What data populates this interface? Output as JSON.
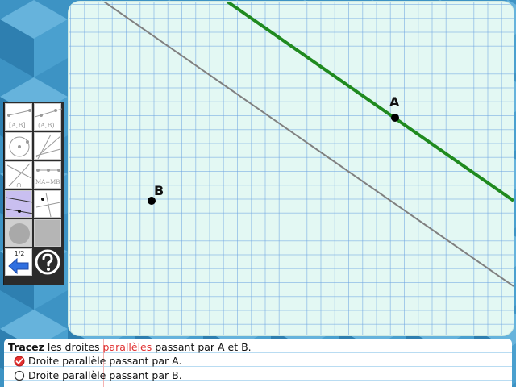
{
  "page": {
    "background": "#3d93c4",
    "canvas_background": "#e3f8f3",
    "grid_color": "#8fb8e6"
  },
  "canvas": {
    "points": [
      {
        "label": "A",
        "color": "#000000"
      },
      {
        "label": "B",
        "color": "#000000"
      }
    ],
    "lines": [
      {
        "name": "user-parallel-through-A",
        "color": "#1f8a1f"
      },
      {
        "name": "given-line",
        "color": "#808080"
      }
    ]
  },
  "toolbox": {
    "tools": [
      {
        "name": "segment-tool",
        "caption": "[A,B]"
      },
      {
        "name": "line-tool",
        "caption": "(A,B)"
      },
      {
        "name": "circle-tool",
        "caption": ""
      },
      {
        "name": "lines-tool",
        "caption": ""
      },
      {
        "name": "intersection-tool",
        "caption": "∩"
      },
      {
        "name": "midpoint-tool",
        "caption": "MA=MB"
      },
      {
        "name": "parallel-tool",
        "caption": "",
        "active": true
      },
      {
        "name": "perpendicular-tool",
        "caption": ""
      },
      {
        "name": "disc-tool",
        "caption": ""
      },
      {
        "name": "square-tool",
        "caption": ""
      }
    ],
    "page_counter": "1/2",
    "back_icon": "back-arrow-icon",
    "help_icon": "question-mark-icon",
    "accent_color": "#2f6fe0"
  },
  "instructions": {
    "title_bold": "Tracez",
    "title_mid": " les droites ",
    "title_red": "parallèles",
    "title_end": " passant par A et B.",
    "red_color": "#e03030",
    "tasks": [
      {
        "label": "Droite parallèle passant par A.",
        "done": true
      },
      {
        "label": "Droite parallèle passant par B.",
        "done": false
      }
    ]
  }
}
